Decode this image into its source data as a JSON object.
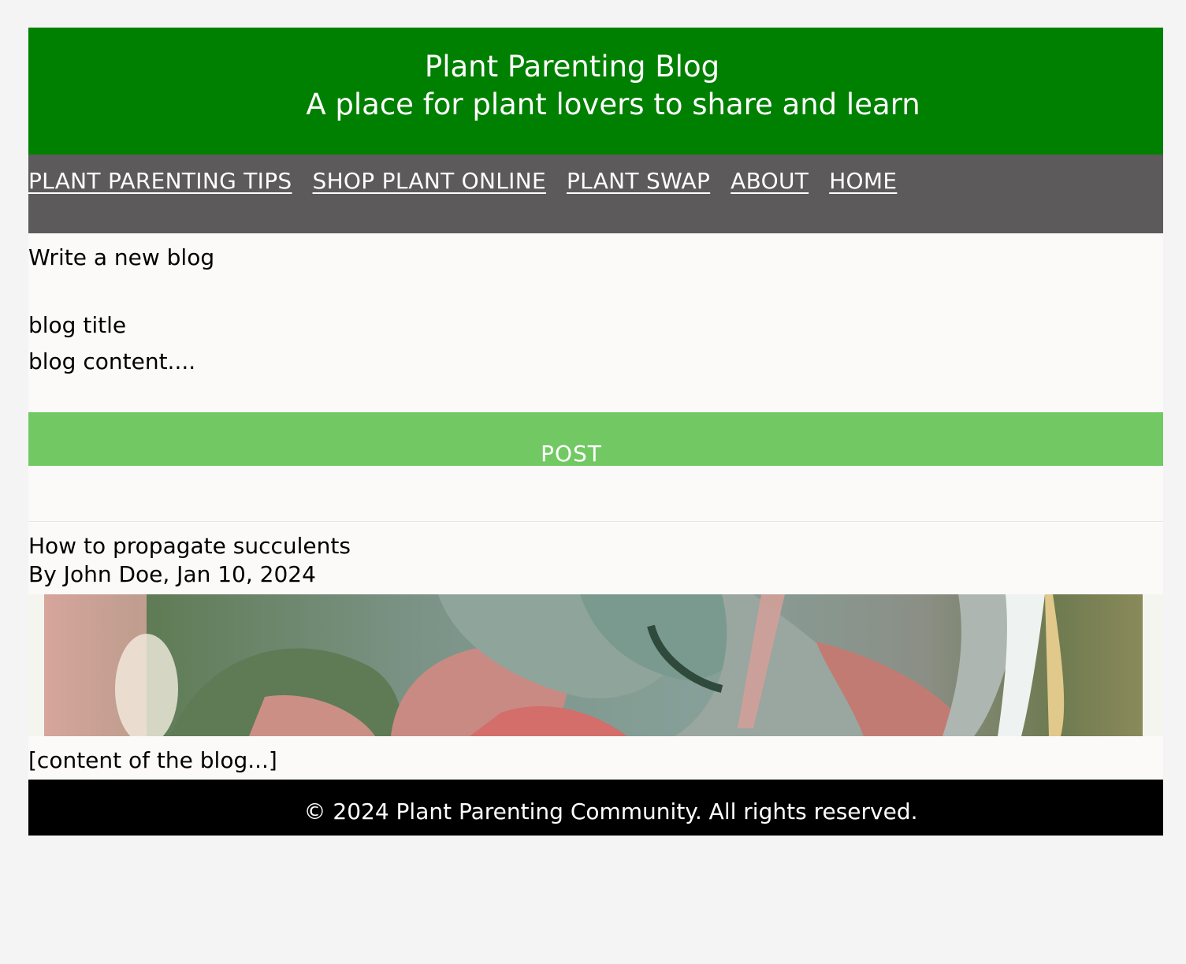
{
  "header": {
    "title": "Plant Parenting Blog",
    "tagline": "A place for plant lovers to share and learn",
    "background": "#008000"
  },
  "nav": {
    "items": [
      {
        "label": "PLANT PARENTING TIPS"
      },
      {
        "label": "SHOP PLANT ONLINE"
      },
      {
        "label": "PLANT SWAP"
      },
      {
        "label": "ABOUT"
      },
      {
        "label": "HOME"
      }
    ],
    "background": "#5c5a5b"
  },
  "composer": {
    "heading": "Write a new blog",
    "title_placeholder": "blog title",
    "content_placeholder": "blog content....",
    "post_label": "POST",
    "post_color": "#72c964"
  },
  "post": {
    "title": "How to propagate succulents",
    "meta": "By John Doe, Jan 10, 2024",
    "image_icon": "succulent-photo",
    "body": "[content of the blog...]"
  },
  "footer": {
    "text": "© 2024 Plant Parenting Community. All rights reserved."
  }
}
